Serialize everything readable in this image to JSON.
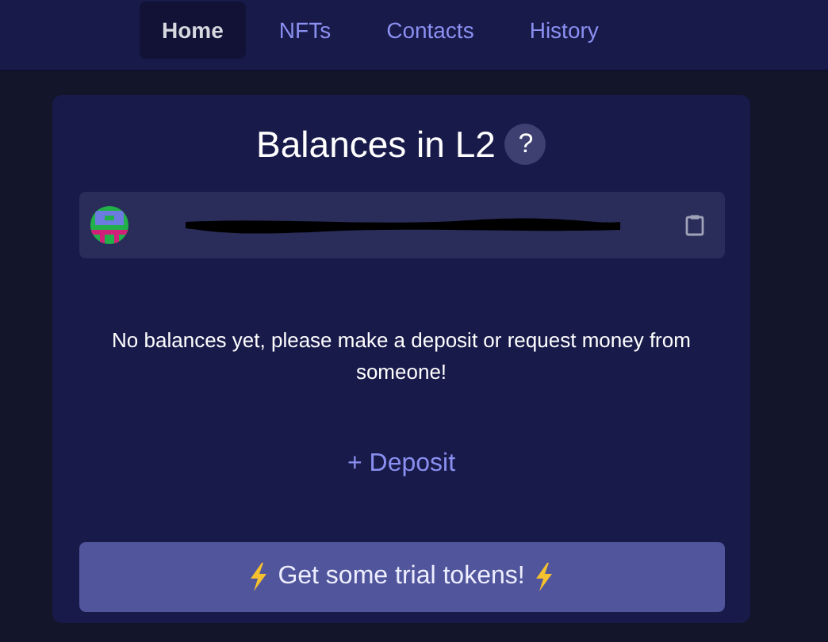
{
  "nav": {
    "tabs": [
      {
        "label": "Home",
        "selected": true
      },
      {
        "label": "NFTs",
        "selected": false
      },
      {
        "label": "Contacts",
        "selected": false
      },
      {
        "label": "History",
        "selected": false
      }
    ]
  },
  "card": {
    "title": "Balances in L2",
    "help": "?",
    "empty_message": "No balances yet, please make a deposit or request money from someone!",
    "deposit_link": "+ Deposit",
    "trial_button": "Get some trial tokens!"
  }
}
